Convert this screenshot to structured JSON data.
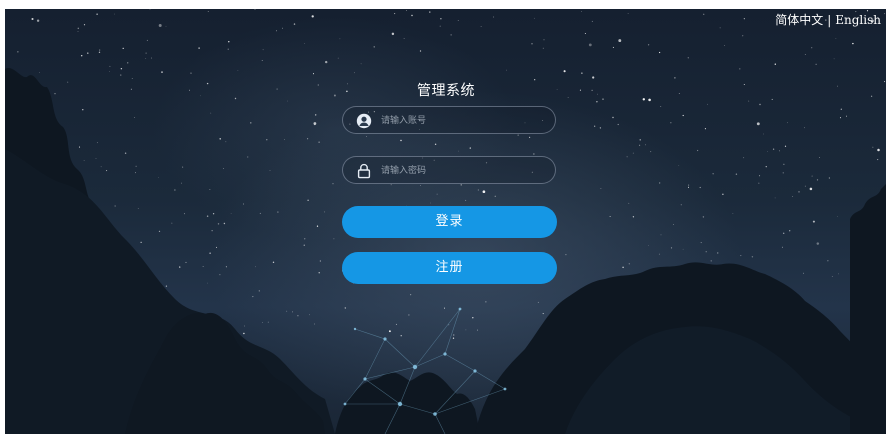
{
  "lang": {
    "simplified_chinese": "简体中文",
    "separator": "|",
    "english": "English"
  },
  "form": {
    "title": "管理系统",
    "username_placeholder": "请输入账号",
    "password_placeholder": "请输入密码",
    "login_label": "登录",
    "register_label": "注册"
  },
  "icons": {
    "username": "user-icon",
    "password": "lock-icon"
  },
  "colors": {
    "button": "#1597e5",
    "sky": "#1b2a3b",
    "trees": "#0e1721",
    "text": "#ffffff"
  }
}
